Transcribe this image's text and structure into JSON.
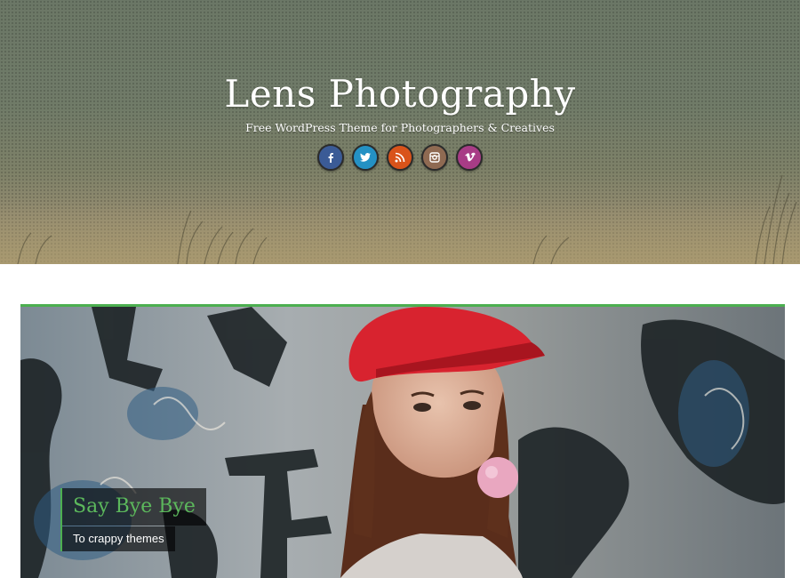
{
  "header": {
    "site_title": "Lens Photography",
    "tagline": "Free WordPress Theme for Photographers & Creatives"
  },
  "social": [
    {
      "name": "facebook",
      "icon": "facebook-icon",
      "glyph": "f",
      "color": "#3b5b96"
    },
    {
      "name": "twitter",
      "icon": "twitter-icon",
      "color": "#2491c4"
    },
    {
      "name": "rss",
      "icon": "rss-icon",
      "color": "#d9531a"
    },
    {
      "name": "instagram",
      "icon": "instagram-icon",
      "color": "#8f6a52"
    },
    {
      "name": "vimeo",
      "icon": "vimeo-icon",
      "glyph": "v",
      "color": "#a83c86"
    }
  ],
  "slider": {
    "accent_color": "#4caf50",
    "slide": {
      "title": "Say Bye Bye",
      "subtitle": "To crappy themes"
    }
  }
}
